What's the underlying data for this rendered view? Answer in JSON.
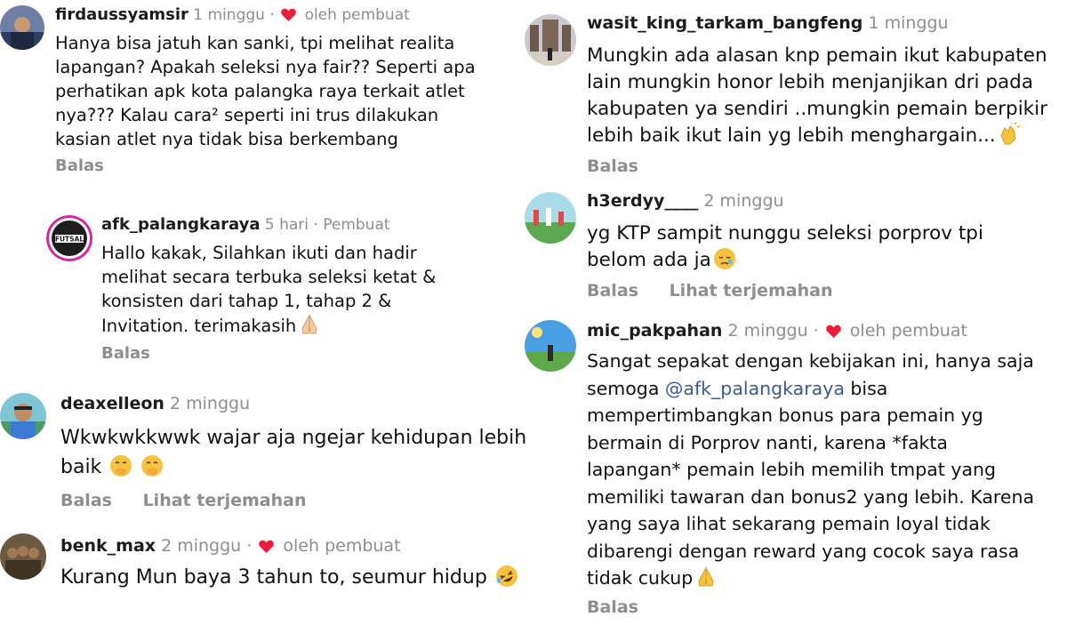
{
  "left": [
    {
      "username": "firdaussyamsir",
      "time": "1 minggu",
      "dot": "·",
      "liked_by_author": true,
      "liked_label": "oleh pembuat",
      "text": "Hanya bisa jatuh kan sanki, tpi melihat realita lapangan? Apakah seleksi nya fair?? Seperti apa perhatikan apk kota palangka raya terkait atlet nya??? Kalau cara² seperti ini trus dilakukan kasian atlet nya tidak bisa berkembang",
      "actions": [
        "Balas"
      ]
    },
    {
      "username": "afk_palangkaraya",
      "time": "5 hari",
      "dot": "·",
      "author_label": "Pembuat",
      "avatar_text": "FUTSAL",
      "text": "Hallo kakak, Silahkan ikuti dan hadir melihat secara terbuka seleksi ketat & konsisten dari tahap 1, tahap 2 & Invitation. terimakasih",
      "emoji": "folded-hands-icon",
      "actions": [
        "Balas"
      ]
    },
    {
      "username": "deaxelleon",
      "time": "2 minggu",
      "text": "Wkwkwkkwwk wajar aja ngejar kehidupan lebih baik",
      "emoji": "face-hand-over-mouth-icon",
      "actions": [
        "Balas",
        "Lihat terjemahan"
      ]
    },
    {
      "username": "benk_max",
      "time": "2 minggu",
      "dot": "·",
      "liked_by_author": true,
      "liked_label": "oleh pembuat",
      "text": "Kurang Mun baya 3 tahun to, seumur hidup",
      "emoji": "rolling-laughing-icon"
    }
  ],
  "right": [
    {
      "username": "wasit_king_tarkam_bangfeng",
      "time": "1 minggu",
      "text": "Mungkin ada alasan knp pemain ikut kabupaten lain mungkin honor lebih menjanjikan dri pada kabupaten ya sendiri ..mungkin pemain berpikir lebih baik ikut lain yg lebih menghargain...",
      "emoji": "clapping-hands-icon",
      "actions": [
        "Balas"
      ]
    },
    {
      "username": "h3erdyy____",
      "time": "2 minggu",
      "text": "yg KTP sampit nunggu seleksi porprov tpi belom ada ja",
      "emoji": "crying-face-icon",
      "actions": [
        "Balas",
        "Lihat terjemahan"
      ]
    },
    {
      "username": "mic_pakpahan",
      "time": "2 minggu",
      "dot": "·",
      "liked_by_author": true,
      "liked_label": "oleh pembuat",
      "text_before": "Sangat sepakat dengan kebijakan ini, hanya saja semoga ",
      "mention": "@afk_palangkaraya",
      "text_after": " bisa mempertimbangkan bonus para pemain yg bermain di Porprov nanti, karena *fakta lapangan* pemain lebih memilih tmpat yang memiliki tawaran dan bonus2 yang lebih. Karena yang saya lihat sekarang pemain loyal tidak dibarengi dengan reward yang cocok saya rasa tidak cukup",
      "emoji": "folded-hands-icon",
      "actions": [
        "Balas"
      ]
    }
  ],
  "colors": {
    "heart": "#ed1c3a",
    "meta_gray": "#8e8e8e",
    "mention": "#3b5998",
    "emoji_yellow": "#f7c23e"
  }
}
